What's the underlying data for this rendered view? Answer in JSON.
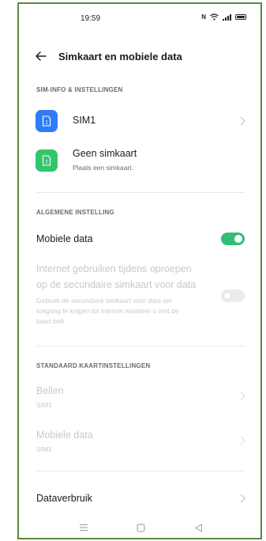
{
  "status_bar": {
    "time": "19:59",
    "nfc_label": "N"
  },
  "header": {
    "title": "Simkaart en mobiele data"
  },
  "sim_section": {
    "title": "SIM-INFO & INSTELLINGEN",
    "items": [
      {
        "label": "SIM1",
        "icon_number": "1",
        "icon_color": "#2f7df6"
      },
      {
        "label": "Geen simkaart",
        "sublabel": "Plaats een simkaart.",
        "icon_number": "2",
        "icon_color": "#35c46e"
      }
    ]
  },
  "general_section": {
    "title": "ALGEMENE INSTELLING",
    "mobile_data": {
      "label": "Mobiele data",
      "enabled": true
    },
    "secondary_sim": {
      "label_line1": "Internet gebruiken tijdens oproepen",
      "label_line2": "op de secundaire simkaart voor data",
      "desc_line1": "Gebruik de secundaire simkaart voor data om",
      "desc_line2": "toegang te krijgen tot internet wanneer u met de",
      "desc_line3": "kaart belt.",
      "enabled": false
    }
  },
  "default_card_section": {
    "title": "STANDAARD KAARTINSTELLINGEN",
    "items": [
      {
        "label": "Bellen",
        "sublabel": "SIM1"
      },
      {
        "label": "Mobiele data",
        "sublabel": "SIM1"
      }
    ]
  },
  "data_usage": {
    "label": "Dataverbruik"
  },
  "colors": {
    "accent_green": "#2fc073",
    "frame_border": "#5b8a3c",
    "disabled_text": "#c8c8c8"
  }
}
